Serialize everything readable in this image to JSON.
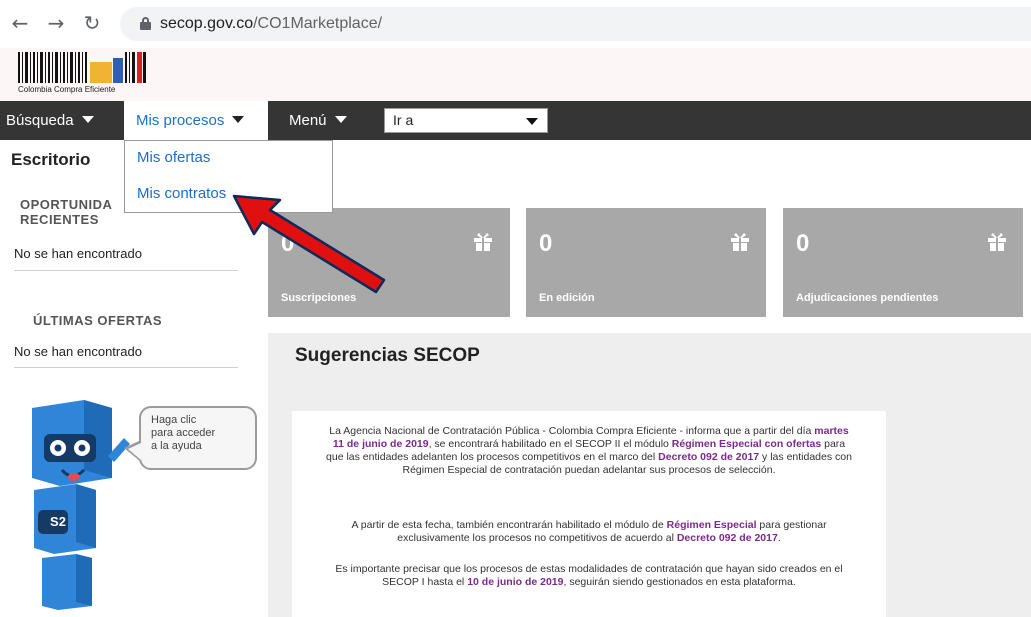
{
  "browser": {
    "url_host": "secop.gov.co",
    "url_path": "/CO1Marketplace/"
  },
  "logo": {
    "caption": "Colombia Compra Eficiente"
  },
  "topnav": {
    "busqueda": "Búsqueda",
    "mis_procesos": "Mis procesos",
    "menu": "Menú",
    "ir_a": "Ir a"
  },
  "dropdown": {
    "items": [
      "Mis ofertas",
      "Mis contratos"
    ]
  },
  "sidebar": {
    "title": "Escritorio",
    "opportunities_heading": "OPORTUNIDA\nRECIENTES",
    "opportunities_empty": "No se han encontrado",
    "offers_heading": "ÚLTIMAS OFERTAS",
    "offers_empty": "No se han encontrado"
  },
  "tiles": [
    {
      "value": "0",
      "label": "Suscripciones"
    },
    {
      "value": "0",
      "label": "En edición"
    },
    {
      "value": "0",
      "label": "Adjudicaciones pendientes"
    }
  ],
  "suggestions": {
    "title": "Sugerencias SECOP",
    "p1_a": "La Agencia Nacional de Contratación Pública - Colombia Compra Eficiente - informa que a partir del día ",
    "p1_b": "martes 11 de junio de 2019",
    "p1_c": ", se encontrará habilitado en el SECOP II el módulo ",
    "p1_d": "Régimen Especial con ofertas",
    "p1_e": " para que las entidades adelanten los procesos competitivos en el marco del ",
    "p1_f": "Decreto 092 de 2017",
    "p1_g": " y las entidades con Régimen Especial de contratación puedan adelantar sus procesos de selección.",
    "p2_a": "A partir de esta fecha, también encontrarán habilitado el módulo de ",
    "p2_b": "Régimen Especial",
    "p2_c": " para gestionar exclusivamente los procesos no competitivos de acuerdo al ",
    "p2_d": "Decreto 092 de 2017",
    "p2_e": ".",
    "p3_a": "Es importante precisar que los procesos de estas modalidades de contratación que hayan sido creados en el SECOP I hasta el ",
    "p3_b": "10 de junio de 2019",
    "p3_c": ", seguirán siendo gestionados en esta plataforma."
  },
  "mascot": {
    "bubble_text": "Haga clic\npara acceder\na la ayuda",
    "badge": "S2"
  },
  "colors": {
    "nav_bg": "#353535",
    "link": "#1a6ec8",
    "tile_bg": "#a8a8a8",
    "highlight": "#7a2b8c",
    "mascot_blue": "#2f86d8",
    "arrow_red": "#e01010"
  },
  "icons": {
    "back": "back-arrow-icon",
    "forward": "forward-arrow-icon",
    "reload": "reload-icon",
    "lock": "lock-icon",
    "tile": "gift-box-icon"
  }
}
